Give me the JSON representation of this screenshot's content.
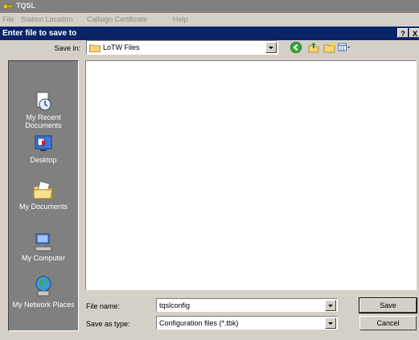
{
  "app": {
    "title": "TQSL",
    "menu": [
      "File",
      "Station Location",
      "Callsign Certificate",
      "Help"
    ]
  },
  "dialog": {
    "title": "Enter file to save to",
    "help_label": "?",
    "close_label": "X",
    "save_in_label": "Save in:",
    "save_in_value": "LoTW Files"
  },
  "places": [
    {
      "label": "My Recent Documents",
      "icon": "recent-documents-icon"
    },
    {
      "label": "Desktop",
      "icon": "desktop-icon"
    },
    {
      "label": "My Documents",
      "icon": "my-documents-icon"
    },
    {
      "label": "My Computer",
      "icon": "my-computer-icon"
    },
    {
      "label": "My Network Places",
      "icon": "network-places-icon"
    }
  ],
  "form": {
    "file_name_label": "File name:",
    "file_name_value": "tqslconfig",
    "save_type_label": "Save as type:",
    "save_type_value": "Configuration files (*.tbk)",
    "save_button": "Save",
    "cancel_button": "Cancel"
  },
  "colors": {
    "dialog_title_bg": "#0a246a",
    "inactive_title_bg": "#808080",
    "face": "#d4d0c8",
    "places_bg": "#808080"
  }
}
